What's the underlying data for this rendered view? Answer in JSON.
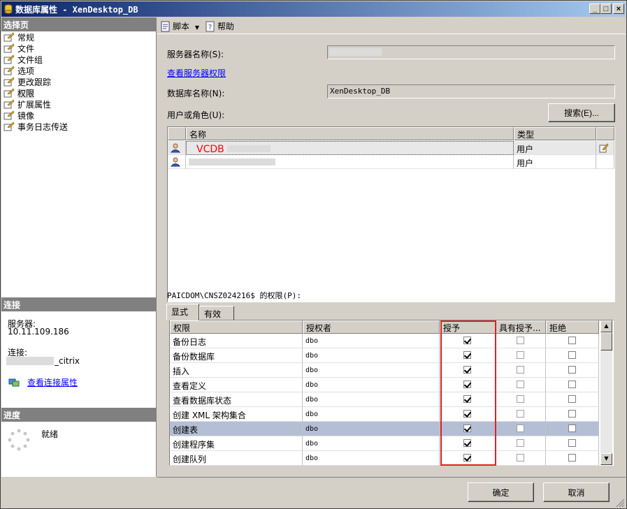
{
  "window": {
    "title": "数据库属性 - XenDesktop_DB",
    "min_label": "_",
    "max_label": "□",
    "close_label": "×"
  },
  "left": {
    "select_page_header": "选择页",
    "pages": [
      {
        "label": "常规"
      },
      {
        "label": "文件"
      },
      {
        "label": "文件组"
      },
      {
        "label": "选项"
      },
      {
        "label": "更改跟踪"
      },
      {
        "label": "权限"
      },
      {
        "label": "扩展属性"
      },
      {
        "label": "镜像"
      },
      {
        "label": "事务日志传送"
      }
    ],
    "connection_header": "连接",
    "server_label": "服务器:",
    "server_value": "10.11.109.186",
    "connect_label": "连接:",
    "connect_value": "_citrix",
    "view_conn_props": "查看连接属性",
    "progress_header": "进度",
    "progress_status": "就绪"
  },
  "toolbar": {
    "script_label": "脚本",
    "help_label": "帮助"
  },
  "main": {
    "server_name_label": "服务器名称(S):",
    "view_server_perms": "查看服务器权限",
    "db_name_label": "数据库名称(N):",
    "db_name_value": "XenDesktop_DB",
    "users_roles_label": "用户或角色(U):",
    "search_button": "搜索(E)...",
    "users_columns": {
      "name": "名称",
      "type": "类型"
    },
    "users": [
      {
        "name": "VCDB",
        "type": "用户"
      },
      {
        "name": "",
        "type": "用户"
      }
    ],
    "permissions_for": "PAICDOM\\CNSZ024216$ 的权限(P):",
    "tabs": {
      "explicit": "显式",
      "effective": "有效"
    },
    "perm_columns": {
      "permission": "权限",
      "grantor": "授权者",
      "grant": "授予",
      "with_grant": "具有授予...",
      "deny": "拒绝"
    },
    "permissions": [
      {
        "permission": "备份日志",
        "grantor": "dbo",
        "grant": true,
        "with_grant": false,
        "deny": false
      },
      {
        "permission": "备份数据库",
        "grantor": "dbo",
        "grant": true,
        "with_grant": false,
        "deny": false
      },
      {
        "permission": "插入",
        "grantor": "dbo",
        "grant": true,
        "with_grant": false,
        "deny": false
      },
      {
        "permission": "查看定义",
        "grantor": "dbo",
        "grant": true,
        "with_grant": false,
        "deny": false
      },
      {
        "permission": "查看数据库状态",
        "grantor": "dbo",
        "grant": true,
        "with_grant": false,
        "deny": false
      },
      {
        "permission": "创建 XML 架构集合",
        "grantor": "dbo",
        "grant": true,
        "with_grant": false,
        "deny": false
      },
      {
        "permission": "创建表",
        "grantor": "dbo",
        "grant": true,
        "with_grant": false,
        "deny": false
      },
      {
        "permission": "创建程序集",
        "grantor": "dbo",
        "grant": true,
        "with_grant": false,
        "deny": false
      },
      {
        "permission": "创建队列",
        "grantor": "dbo",
        "grant": true,
        "with_grant": false,
        "deny": false
      }
    ],
    "selected_permission_index": 6
  },
  "footer": {
    "ok_button": "确定",
    "cancel_button": "取消"
  },
  "colors": {
    "title_start": "#0a246a",
    "title_end": "#a6caf0",
    "highlight_box": "#e02020",
    "selection": "#b4bfd6",
    "vcdb_text": "#ff0000"
  }
}
